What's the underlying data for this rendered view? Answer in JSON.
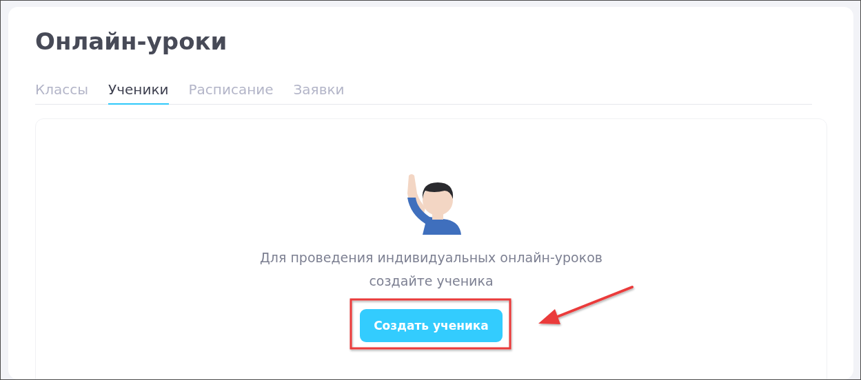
{
  "page": {
    "title": "Онлайн-уроки"
  },
  "tabs": [
    {
      "label": "Классы",
      "selected": false
    },
    {
      "label": "Ученики",
      "selected": true
    },
    {
      "label": "Расписание",
      "selected": false
    },
    {
      "label": "Заявки",
      "selected": false
    }
  ],
  "empty_state": {
    "message": "Для проведения индивидуальных онлайн-уроков создайте ученика",
    "button": "Создать ученика"
  }
}
